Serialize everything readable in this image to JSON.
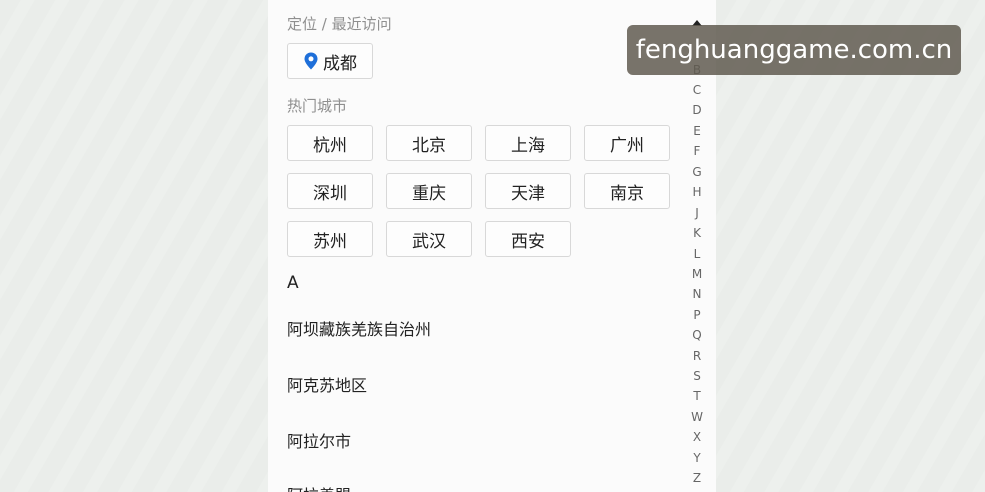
{
  "location": {
    "section_title": "定位 / 最近访问",
    "current_city": "成都"
  },
  "hot_cities": {
    "section_title": "热门城市",
    "items": [
      "杭州",
      "北京",
      "上海",
      "广州",
      "深圳",
      "重庆",
      "天津",
      "南京",
      "苏州",
      "武汉",
      "西安"
    ]
  },
  "city_list": {
    "groups": [
      {
        "letter": "A",
        "cities": [
          "阿坝藏族羌族自治州",
          "阿克苏地区",
          "阿拉尔市",
          "阿拉善盟"
        ]
      }
    ]
  },
  "index_bar": {
    "letters": [
      "B",
      "C",
      "D",
      "E",
      "F",
      "G",
      "H",
      "J",
      "K",
      "L",
      "M",
      "N",
      "P",
      "Q",
      "R",
      "S",
      "T",
      "W",
      "X",
      "Y",
      "Z"
    ]
  },
  "watermark": {
    "text": "fenghuanggame.com.cn"
  },
  "colors": {
    "pin": "#1e6fd9",
    "panel_bg": "#fbfbfb",
    "outer_bg": "#ecefec"
  }
}
